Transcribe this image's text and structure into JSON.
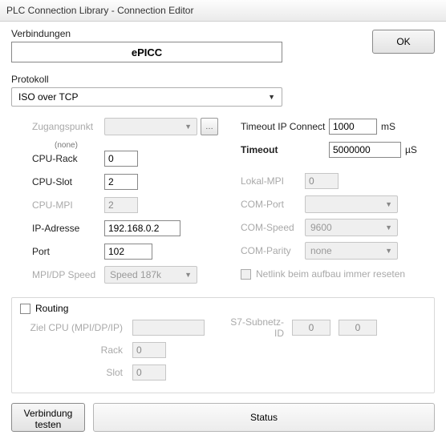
{
  "window": {
    "title": "PLC Connection Library - Connection Editor"
  },
  "header": {
    "verbindungen_label": "Verbindungen",
    "connection_name": "ePICC",
    "ok": "OK"
  },
  "protocol": {
    "label": "Protokoll",
    "value": "ISO over TCP"
  },
  "left": {
    "zugangspunkt": {
      "label": "Zugangspunkt",
      "value": "",
      "none": "(none)"
    },
    "cpu_rack": {
      "label": "CPU-Rack",
      "value": "0"
    },
    "cpu_slot": {
      "label": "CPU-Slot",
      "value": "2"
    },
    "cpu_mpi": {
      "label": "CPU-MPI",
      "value": "2"
    },
    "ip": {
      "label": "IP-Adresse",
      "value": "192.168.0.2"
    },
    "port": {
      "label": "Port",
      "value": "102"
    },
    "mpi_speed": {
      "label": "MPI/DP Speed",
      "value": "Speed 187k"
    }
  },
  "right": {
    "timeout_ip": {
      "label": "Timeout IP Connect",
      "value": "1000",
      "unit": "mS"
    },
    "timeout": {
      "label": "Timeout",
      "value": "5000000",
      "unit": "µS"
    },
    "lokal_mpi": {
      "label": "Lokal-MPI",
      "value": "0"
    },
    "com_port": {
      "label": "COM-Port",
      "value": ""
    },
    "com_speed": {
      "label": "COM-Speed",
      "value": "9600"
    },
    "com_parity": {
      "label": "COM-Parity",
      "value": "none"
    },
    "netlink": {
      "label": "Netlink beim aufbau immer reseten"
    }
  },
  "routing": {
    "title": "Routing",
    "ziel": {
      "label": "Ziel CPU (MPI/DP/IP)",
      "value": ""
    },
    "rack": {
      "label": "Rack",
      "value": "0"
    },
    "slot": {
      "label": "Slot",
      "value": "0"
    },
    "subnetz": {
      "label": "S7-Subnetz-ID",
      "a": "0",
      "b": "0"
    }
  },
  "footer": {
    "test": "Verbindung\ntesten",
    "status": "Status"
  }
}
